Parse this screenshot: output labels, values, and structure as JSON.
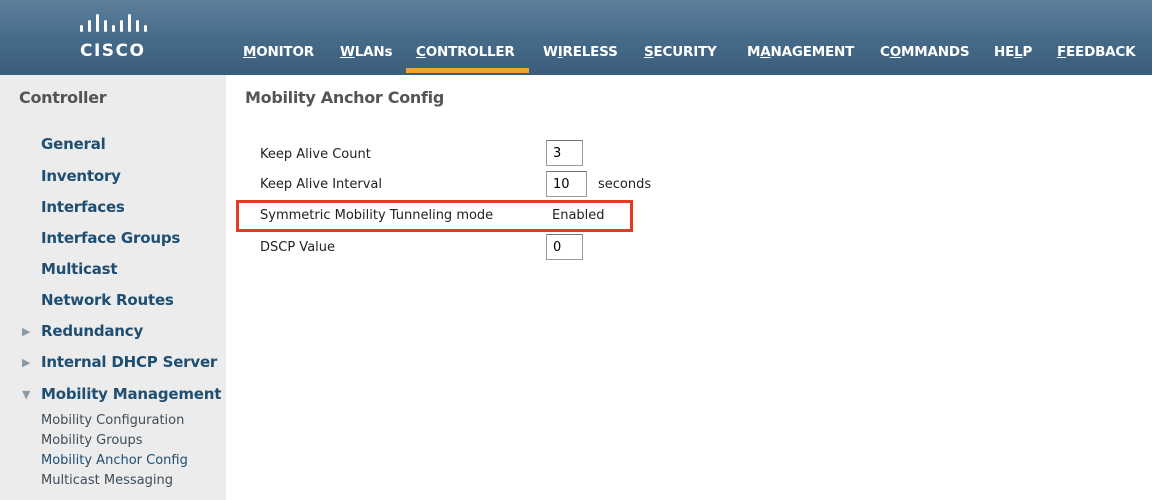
{
  "brand": {
    "logo_text": "CISCO"
  },
  "nav": {
    "items": [
      {
        "pre": "",
        "u": "M",
        "post": "ONITOR"
      },
      {
        "pre": "",
        "u": "W",
        "post": "LANs"
      },
      {
        "pre": "",
        "u": "C",
        "post": "ONTROLLER"
      },
      {
        "pre": "W",
        "u": "I",
        "post": "RELESS"
      },
      {
        "pre": "",
        "u": "S",
        "post": "ECURITY"
      },
      {
        "pre": "M",
        "u": "A",
        "post": "NAGEMENT"
      },
      {
        "pre": "C",
        "u": "O",
        "post": "MMANDS"
      },
      {
        "pre": "HE",
        "u": "L",
        "post": "P"
      },
      {
        "pre": "",
        "u": "F",
        "post": "EEDBACK"
      }
    ],
    "active": "CONTROLLER",
    "active_color": "#f0a330"
  },
  "sidebar": {
    "title": "Controller",
    "items": [
      {
        "label": "General"
      },
      {
        "label": "Inventory"
      },
      {
        "label": "Interfaces"
      },
      {
        "label": "Interface Groups"
      },
      {
        "label": "Multicast"
      },
      {
        "label": "Network Routes"
      },
      {
        "label": "Redundancy",
        "icon": "chevron-right-icon"
      },
      {
        "label": "Internal DHCP Server",
        "icon": "chevron-right-icon"
      },
      {
        "label": "Mobility Management",
        "icon": "chevron-down-icon"
      }
    ],
    "sub_items": [
      {
        "label": "Mobility Configuration"
      },
      {
        "label": "Mobility Groups"
      },
      {
        "label": "Mobility Anchor Config",
        "active": true
      },
      {
        "label": "Multicast Messaging"
      }
    ]
  },
  "main": {
    "title": "Mobility Anchor Config",
    "rows": {
      "keep_alive_count": {
        "label": "Keep Alive Count",
        "value": "3"
      },
      "keep_alive_interval": {
        "label": "Keep Alive Interval",
        "value": "10",
        "unit": "seconds"
      },
      "symmetric_tunneling": {
        "label": "Symmetric Mobility Tunneling mode",
        "value": "Enabled"
      },
      "dscp_value": {
        "label": "DSCP Value",
        "value": "0"
      }
    },
    "highlight_color": "#e23b22"
  }
}
